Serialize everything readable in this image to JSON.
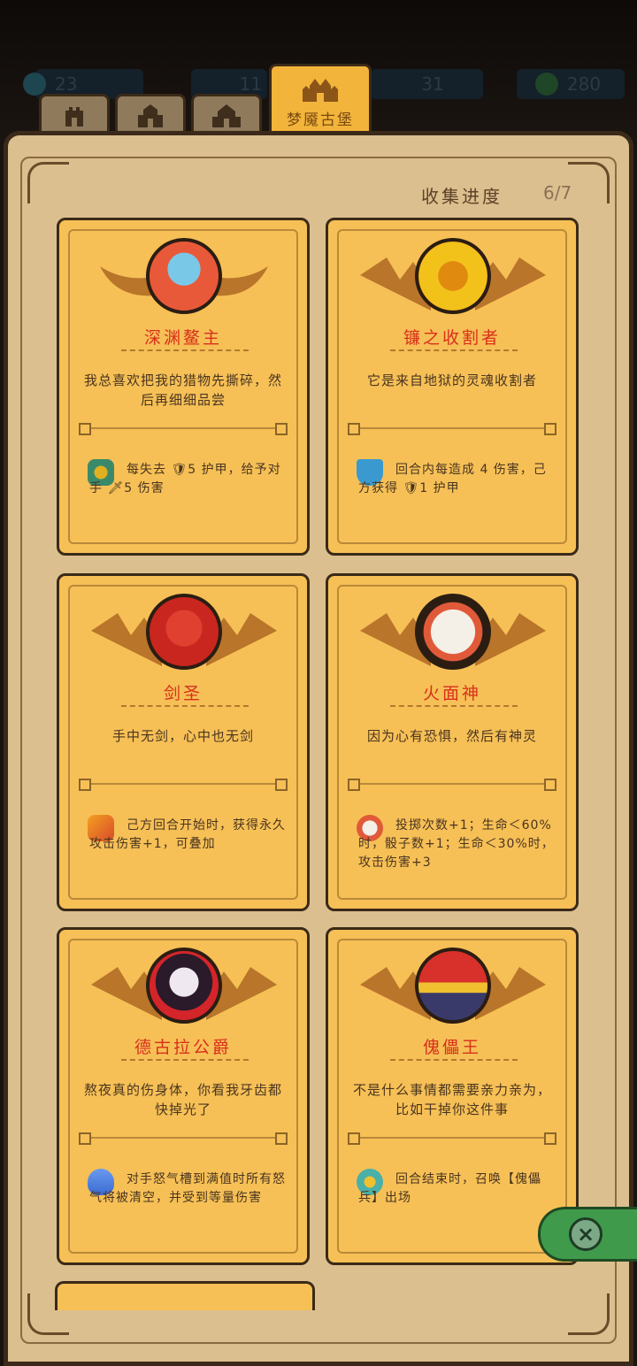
{
  "header": {
    "resources": [
      {
        "name": "gems",
        "value": "23",
        "icon": "gem-icon",
        "color": "#2a5a66"
      },
      {
        "name": "gold",
        "value": "11",
        "icon": "coin-icon",
        "color": "#6a4a2a"
      },
      {
        "name": "keys",
        "value": "31",
        "icon": "key-icon",
        "color": "#3a4a66"
      },
      {
        "name": "energy",
        "value": "280",
        "icon": "leaf-icon",
        "color": "#2f6a3a"
      }
    ],
    "tabs": [
      {
        "label": "",
        "icon": "castle-tower-icon"
      },
      {
        "label": "",
        "icon": "castle-gate-icon"
      },
      {
        "label": "",
        "icon": "castle-keep-icon"
      },
      {
        "label": "梦魇古堡",
        "icon": "palace-icon",
        "active": true
      }
    ]
  },
  "collection": {
    "progress_label": "收集进度",
    "progress_value": "6/7"
  },
  "cards": [
    {
      "name": "深渊鳌主",
      "desc": "我总喜欢把我的猎物先撕碎，然后再细细品尝",
      "skill": "每失去 🛡5 护甲，给予对手 🗡5 伤害",
      "portrait": "abyss-lord-portrait",
      "portrait_color": "#e8593a",
      "skill_icon": "horned-mask-icon",
      "skill_color": "#3a8a6a",
      "name_color": "#e0431f"
    },
    {
      "name": "镰之收割者",
      "desc": "它是来自地狱的灵魂收割者",
      "skill": "回合内每造成 4 伤害，己方获得 🛡1 护甲",
      "portrait": "reaper-portrait",
      "portrait_color": "#f2c21a",
      "skill_icon": "crystal-shield-icon",
      "skill_color": "#3a9ad0",
      "name_color": "#e0431f"
    },
    {
      "name": "剑圣",
      "desc": "手中无剑，心中也无剑",
      "skill": "己方回合开始时，获得永久攻击伤害+1，可叠加",
      "portrait": "sword-saint-portrait",
      "portrait_color": "#c8261e",
      "skill_icon": "flaming-sword-icon",
      "skill_color": "#d84a2a",
      "name_color": "#e0431f"
    },
    {
      "name": "火面神",
      "desc": "因为心有恐惧，然后有神灵",
      "skill": "投掷次数+1；生命＜60%时，骰子数+1；生命＜30%时，攻击伤害+3",
      "portrait": "fire-mask-god-portrait",
      "portrait_color": "#f4f0e8",
      "skill_icon": "fire-mask-icon",
      "skill_color": "#e05a3a",
      "name_color": "#e0431f"
    },
    {
      "name": "德古拉公爵",
      "desc": "熬夜真的伤身体，你看我牙齿都快掉光了",
      "skill": "对手怒气槽到满值时所有怒气将被清空，并受到等量伤害",
      "portrait": "dracula-portrait",
      "portrait_color": "#d4252a",
      "skill_icon": "blue-flame-icon",
      "skill_color": "#3a6ad0",
      "name_color": "#e0431f"
    },
    {
      "name": "傀儡王",
      "desc": "不是什么事情都需要亲力亲为，比如干掉你这件事",
      "skill": "回合结束时，召唤【傀儡兵】出场",
      "portrait": "puppet-king-portrait",
      "portrait_color": "#d8302a",
      "skill_icon": "puppet-head-icon",
      "skill_color": "#4ab0a8",
      "name_color": "#e0431f"
    }
  ],
  "close_button": {
    "icon": "close-icon",
    "color": "#3f9a4c"
  }
}
